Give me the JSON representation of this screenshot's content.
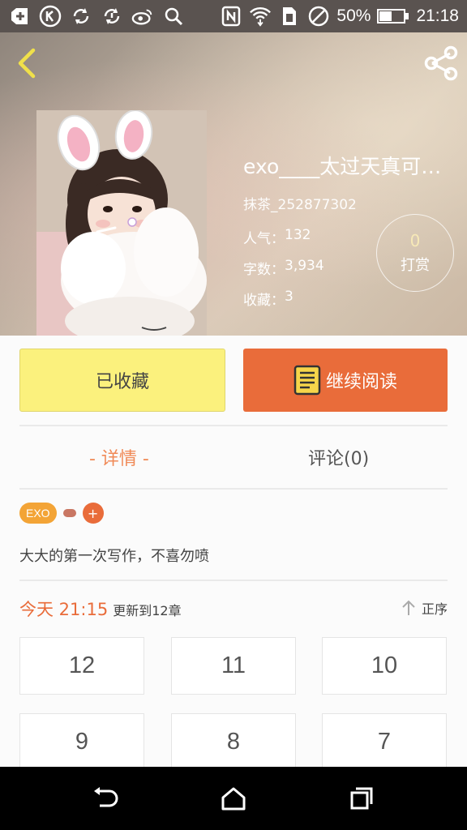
{
  "status_bar": {
    "battery_percent": "50%",
    "time": "21:18",
    "icons": [
      "plus-icon",
      "k-app-icon",
      "sync-icon",
      "sync-alt-icon",
      "weibo-icon",
      "search-icon",
      "nfc-icon",
      "wifi-icon",
      "sim-icon",
      "no-disturb-icon",
      "battery-icon"
    ]
  },
  "header": {
    "back_icon": "chevron-left-icon",
    "share_icon": "share-icon"
  },
  "book": {
    "title": "exo____太过天真可…",
    "author": "抹茶_252877302",
    "popularity_label": "人气：",
    "popularity": "132",
    "words_label": "字数：",
    "words": "3,934",
    "favorites_label": "收藏：",
    "favorites": "3"
  },
  "tip": {
    "count": "0",
    "label": "打赏"
  },
  "actions": {
    "collected_label": "已收藏",
    "continue_label": "继续阅读"
  },
  "tabs": {
    "detail": "- 详情 -",
    "comments": "评论(0)"
  },
  "tags": {
    "items": [
      "EXO"
    ],
    "add": "+"
  },
  "description": "大大的第一次写作，不喜勿喷",
  "update": {
    "time": "今天 21:15",
    "text": "更新到12章",
    "sort_label": "正序"
  },
  "chapters": [
    "12",
    "11",
    "10",
    "9",
    "8",
    "7"
  ],
  "colors": {
    "accent": "#e96c3a",
    "collect_bg": "#fbf17d",
    "tag_orange": "#f3a436"
  }
}
